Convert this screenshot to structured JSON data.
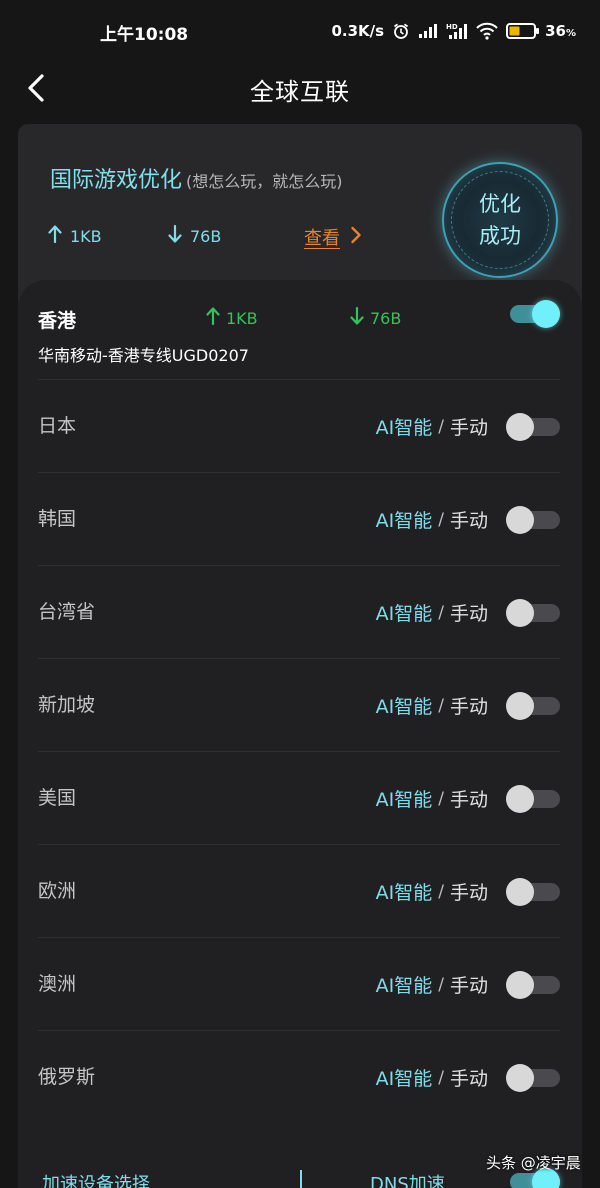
{
  "status_bar": {
    "time": "上午10:08",
    "speed": "0.3K/s",
    "battery": "36",
    "battery_unit": "%"
  },
  "header": {
    "title": "全球互联"
  },
  "optimization": {
    "title": "国际游戏优化",
    "subtitle": "(想怎么玩，就怎么玩)",
    "upload": "1KB",
    "download": "76B",
    "view_label": "查看",
    "badge_label": "优化成功"
  },
  "hongkong": {
    "name": "香港",
    "upload": "1KB",
    "download": "76B",
    "line": "华南移动-香港专线UGD0207",
    "enabled": true
  },
  "regions": [
    {
      "name": "日本",
      "ai_label": "AI智能",
      "sep": "/",
      "manual_label": "手动",
      "enabled": false
    },
    {
      "name": "韩国",
      "ai_label": "AI智能",
      "sep": "/",
      "manual_label": "手动",
      "enabled": false
    },
    {
      "name": "台湾省",
      "ai_label": "AI智能",
      "sep": "/",
      "manual_label": "手动",
      "enabled": false
    },
    {
      "name": "新加坡",
      "ai_label": "AI智能",
      "sep": "/",
      "manual_label": "手动",
      "enabled": false
    },
    {
      "name": "美国",
      "ai_label": "AI智能",
      "sep": "/",
      "manual_label": "手动",
      "enabled": false
    },
    {
      "name": "欧洲",
      "ai_label": "AI智能",
      "sep": "/",
      "manual_label": "手动",
      "enabled": false
    },
    {
      "name": "澳洲",
      "ai_label": "AI智能",
      "sep": "/",
      "manual_label": "手动",
      "enabled": false
    },
    {
      "name": "俄罗斯",
      "ai_label": "AI智能",
      "sep": "/",
      "manual_label": "手动",
      "enabled": false
    }
  ],
  "footer": {
    "device_select": "加速设备选择",
    "dns_label": "DNS加速",
    "dns_enabled": true
  },
  "watermark": {
    "text": "头条 @凌宇晨"
  },
  "colors": {
    "accent": "#7fdcea",
    "traffic_green": "#35c25a",
    "link_orange": "#e8822b",
    "toggle_on": "#6ff0fa",
    "background": "#161617"
  }
}
